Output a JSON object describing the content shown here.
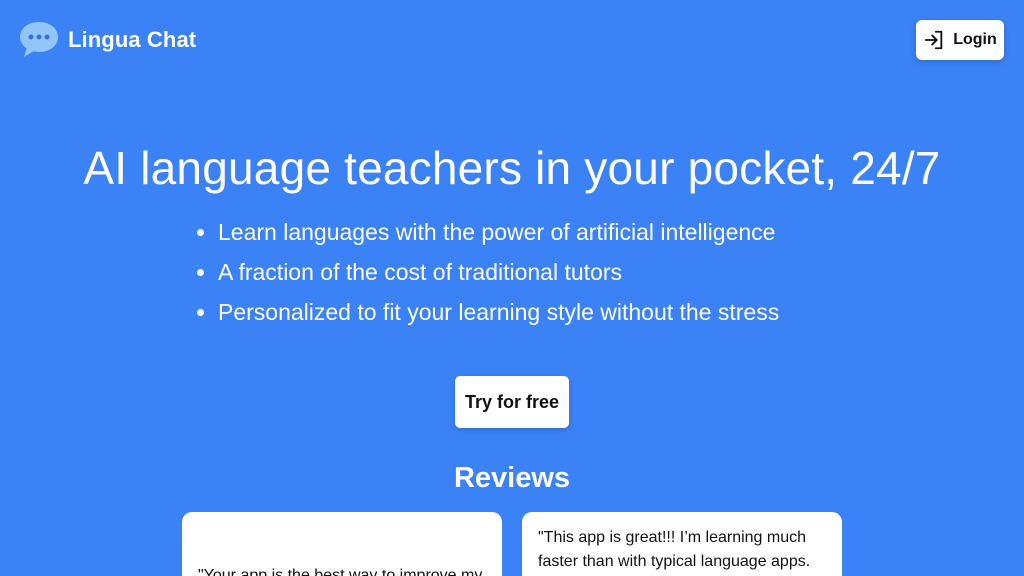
{
  "header": {
    "brand_name": "Lingua Chat",
    "logo_icon": "speech-bubble-icon",
    "login_label": "Login",
    "login_icon": "login-arrow-icon"
  },
  "hero": {
    "title": "AI language teachers in your pocket, 24/7",
    "features": [
      "Learn languages with the power of artificial intelligence",
      "A fraction of the cost of traditional tutors",
      "Personalized to fit your learning style without the stress"
    ],
    "cta_label": "Try for free"
  },
  "reviews": {
    "heading": "Reviews",
    "items": [
      {
        "text": "\"Your app is the best way to improve my"
      },
      {
        "text": "\"This app is great!!! I’m learning much faster than with typical language apps."
      }
    ]
  },
  "colors": {
    "background": "#3b82f6",
    "surface": "#ffffff",
    "text_dark": "#111111",
    "logo_bubble": "#93c5fd"
  }
}
